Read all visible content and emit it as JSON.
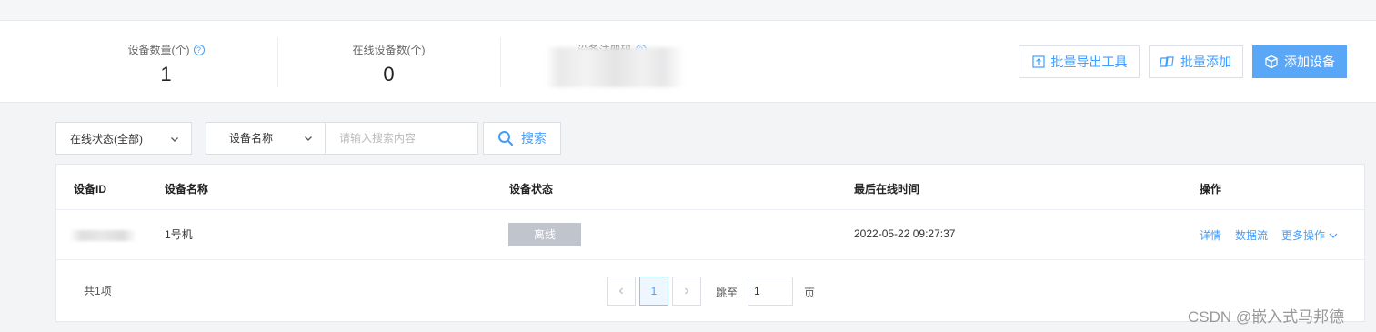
{
  "stats": {
    "device_count_label": "设备数量(个)",
    "device_count_value": "1",
    "online_count_label": "在线设备数(个)",
    "online_count_value": "0",
    "register_code_label": "设备注册码",
    "help_glyph": "?"
  },
  "toolbar": {
    "export_tool_label": "批量导出工具",
    "batch_add_label": "批量添加",
    "add_device_label": "添加设备"
  },
  "filters": {
    "status_select_value": "在线状态(全部)",
    "field_select_value": "设备名称",
    "search_placeholder": "请输入搜索内容",
    "search_button_label": "搜索"
  },
  "table": {
    "columns": {
      "device_id": "设备ID",
      "device_name": "设备名称",
      "status": "设备状态",
      "last_online": "最后在线时间",
      "actions": "操作"
    },
    "rows": [
      {
        "device_name": "1号机",
        "status": "离线",
        "last_online": "2022-05-22 09:27:37",
        "actions": {
          "detail": "详情",
          "data_stream": "数据流",
          "more": "更多操作"
        }
      }
    ],
    "status_color": "#c0c4cc"
  },
  "pagination": {
    "total_text": "共1项",
    "prev_glyph": "‹",
    "current_page": "1",
    "next_glyph": "›",
    "jump_label": "跳至",
    "jump_value": "1",
    "page_unit": "页"
  },
  "watermark": "CSDN @嵌入式马邦德",
  "colors": {
    "accent": "#409eff",
    "primary_button": "#5aa7f7",
    "background": "#f3f4f6"
  }
}
